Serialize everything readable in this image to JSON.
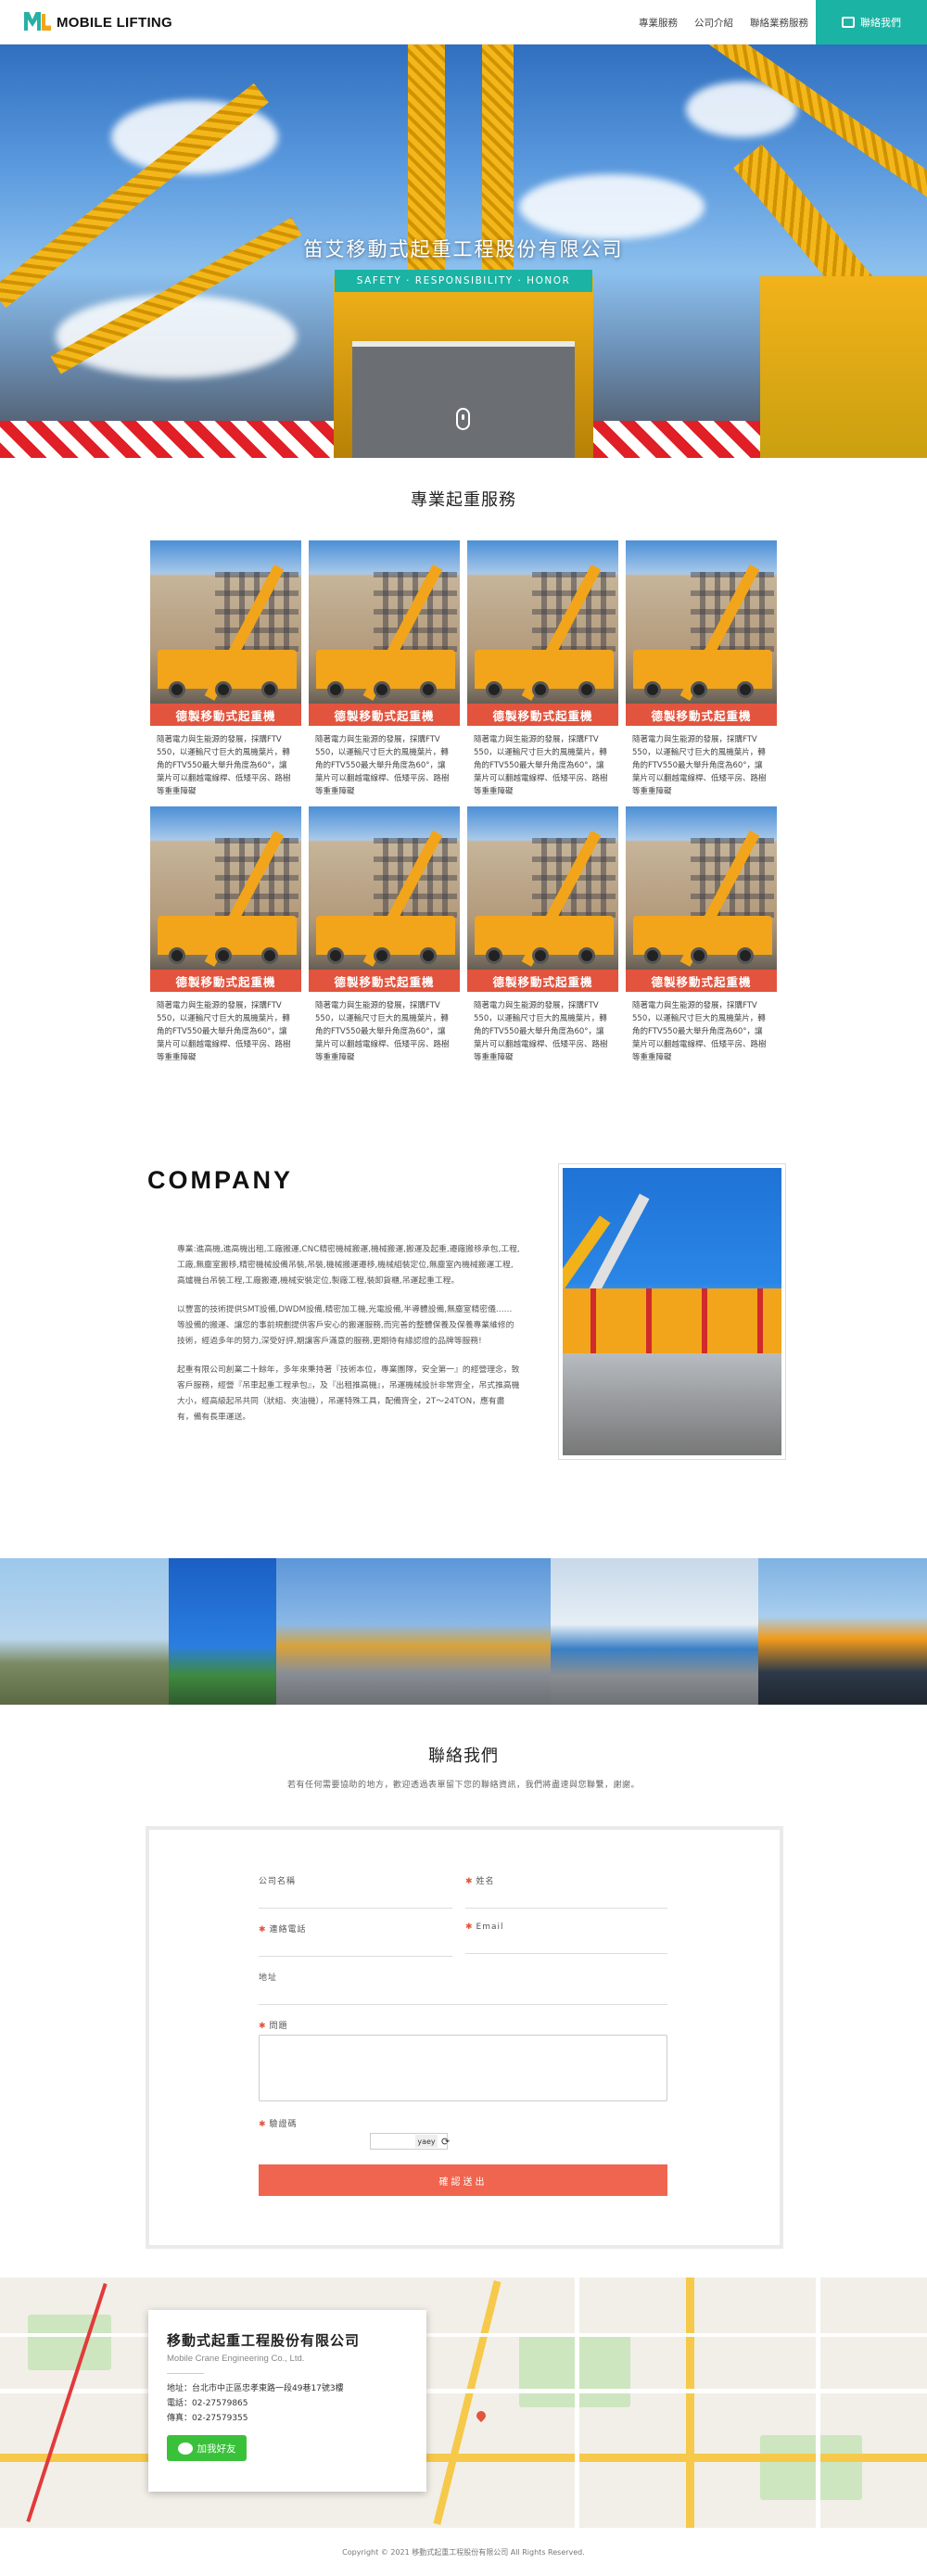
{
  "nav": {
    "logo_text": "MOBILE LIFTING",
    "links": [
      "專業服務",
      "公司介紹",
      "聯絡業務服務"
    ],
    "contact_label": "聯絡我們"
  },
  "hero": {
    "title": "笛艾移動式起重工程股份有限公司",
    "subtitle": "SAFETY · RESPONSIBILITY · HONOR"
  },
  "services": {
    "title": "專業起重服務",
    "cards": [
      {
        "label": "德製移動式起重機",
        "desc": "隨著電力與生能源的發展，採購FTV 550，以運輸尺寸巨大的風機葉片，轉角的FTV550最大舉升角度為60°，讓葉片可以翻越電線桿、低矮平房、路樹等重重障礙"
      },
      {
        "label": "德製移動式起重機",
        "desc": "隨著電力與生能源的發展，採購FTV 550，以運輸尺寸巨大的風機葉片，轉角的FTV550最大舉升角度為60°，讓葉片可以翻越電線桿、低矮平房、路樹等重重障礙"
      },
      {
        "label": "德製移動式起重機",
        "desc": "隨著電力與生能源的發展，採購FTV 550，以運輸尺寸巨大的風機葉片，轉角的FTV550最大舉升角度為60°，讓葉片可以翻越電線桿、低矮平房、路樹等重重障礙"
      },
      {
        "label": "德製移動式起重機",
        "desc": "隨著電力與生能源的發展，採購FTV 550，以運輸尺寸巨大的風機葉片，轉角的FTV550最大舉升角度為60°，讓葉片可以翻越電線桿、低矮平房、路樹等重重障礙"
      },
      {
        "label": "德製移動式起重機",
        "desc": "隨著電力與生能源的發展，採購FTV 550，以運輸尺寸巨大的風機葉片，轉角的FTV550最大舉升角度為60°，讓葉片可以翻越電線桿、低矮平房、路樹等重重障礙"
      },
      {
        "label": "德製移動式起重機",
        "desc": "隨著電力與生能源的發展，採購FTV 550，以運輸尺寸巨大的風機葉片，轉角的FTV550最大舉升角度為60°，讓葉片可以翻越電線桿、低矮平房、路樹等重重障礙"
      },
      {
        "label": "德製移動式起重機",
        "desc": "隨著電力與生能源的發展，採購FTV 550，以運輸尺寸巨大的風機葉片，轉角的FTV550最大舉升角度為60°，讓葉片可以翻越電線桿、低矮平房、路樹等重重障礙"
      },
      {
        "label": "德製移動式起重機",
        "desc": "隨著電力與生能源的發展，採購FTV 550，以運輸尺寸巨大的風機葉片，轉角的FTV550最大舉升角度為60°，讓葉片可以翻越電線桿、低矮平房、路樹等重重障礙"
      }
    ]
  },
  "company": {
    "heading": "COMPANY",
    "paragraphs": [
      "專業:進高機,進高機出租,工廠搬運,CNC精密機械搬運,機械搬運,搬運及起重,遷廠搬移承包,工程,工廠,無塵室搬移,精密機械設備吊裝,吊裝,機械搬運遷移,機械組裝定位,無塵室內機械搬運工程,高爐機台吊裝工程,工廠搬遷,機械安裝定位,製廠工程,裝卸貨櫃,吊運起重工程。",
      "以豐富的技術提供SMT設備,DWDM設備,精密加工機,光電設備,半導體設備,無塵室精密儀……等設備的搬運、讓您的事前規劃提供客戶安心的搬運服務,而完善的整體保養及保養專業維修的技術，經過多年的努力,深受好評,期讓客戶滿意的服務,更期待有緣認證的品牌等服務!",
      "起重有限公司創業二十餘年，多年來秉持著『技術本位，專業團隊，安全第一』的經營理念，致客戶服務，經營『吊車起重工程承包』，及『出租推高機』，吊運機械設計非常齊全，吊式推高機大小，經高級起吊共同（狀組、夾油機），吊運特殊工具，配備齊全，2T～24TON，應有盡有，備有長車運送。"
    ]
  },
  "contact": {
    "title": "聯絡我們",
    "subtitle": "若有任何需要協助的地方，歡迎透過表單留下您的聯絡資訊，我們將盡速與您聯繫，謝謝。",
    "fields": {
      "company": "公司名稱",
      "name": "姓名",
      "phone": "連絡電話",
      "email": "Email",
      "address": "地址",
      "question": "問題",
      "captcha": "驗證碼"
    },
    "captcha_code": "yaey",
    "submit_label": "確認送出"
  },
  "map_card": {
    "company_cn": "移動式起重工程股份有限公司",
    "company_en": "Mobile Crane Engineering Co., Ltd.",
    "address": "地址：台北市中正區忠孝東路一段49巷17號3樓",
    "phone": "電話：02-27579865",
    "fax": "傳真：02-27579355",
    "line_label": "加我好友"
  },
  "footer": {
    "copyright": "Copyright © 2021 移動式起重工程股份有限公司 All Rights Reserved."
  },
  "colors": {
    "accent": "#1bb3a4",
    "card_label": "#e2543e",
    "submit": "#f0654f",
    "line": "#3ac13a"
  }
}
